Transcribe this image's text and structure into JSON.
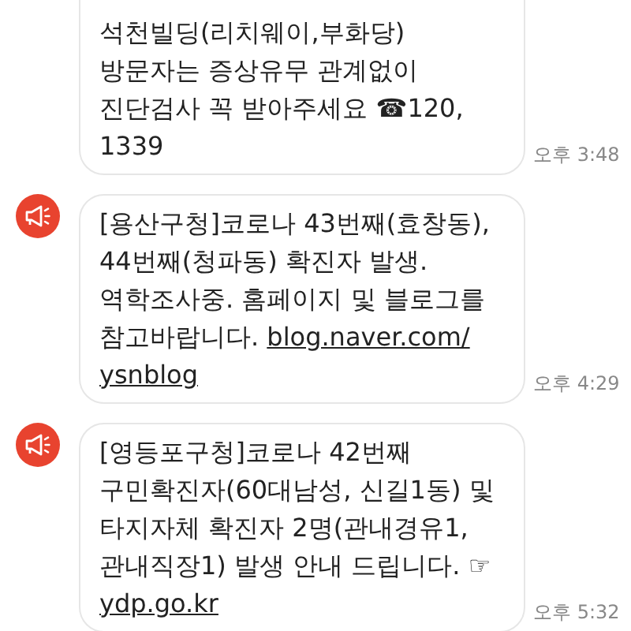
{
  "messages": [
    {
      "icon": false,
      "lines": [
        [
          {
            "kind": "text",
            "text": "석천빌딩(리치웨이,부화당)"
          }
        ],
        [
          {
            "kind": "text",
            "text": "방문자는 증상유무 관계없이"
          }
        ],
        [
          {
            "kind": "text",
            "text": "진단검사 꼭 받아주세요 ☎120,"
          }
        ],
        [
          {
            "kind": "text",
            "text": "1339"
          }
        ]
      ],
      "time": "오후 3:48"
    },
    {
      "icon": true,
      "lines": [
        [
          {
            "kind": "text",
            "text": "[용산구청]코로나 43번째(효창동),"
          }
        ],
        [
          {
            "kind": "text",
            "text": "44번째(청파동) 확진자 발생."
          }
        ],
        [
          {
            "kind": "text",
            "text": "역학조사중. 홈페이지 및 블로그를"
          }
        ],
        [
          {
            "kind": "text",
            "text": "참고바랍니다. "
          },
          {
            "kind": "link",
            "text": "blog.naver.com/"
          }
        ],
        [
          {
            "kind": "link",
            "text": "ysnblog"
          }
        ]
      ],
      "time": "오후 4:29"
    },
    {
      "icon": true,
      "lines": [
        [
          {
            "kind": "text",
            "text": "[영등포구청]코로나 42번째"
          }
        ],
        [
          {
            "kind": "text",
            "text": "구민확진자(60대남성, 신길1동) 및"
          }
        ],
        [
          {
            "kind": "text",
            "text": "타지자체 확진자 2명(관내경유1,"
          }
        ],
        [
          {
            "kind": "text",
            "text": "관내직장1) 발생 안내 드립니다. ☞"
          }
        ],
        [
          {
            "kind": "link",
            "text": "ydp.go.kr"
          }
        ]
      ],
      "time": "오후 5:32"
    }
  ]
}
